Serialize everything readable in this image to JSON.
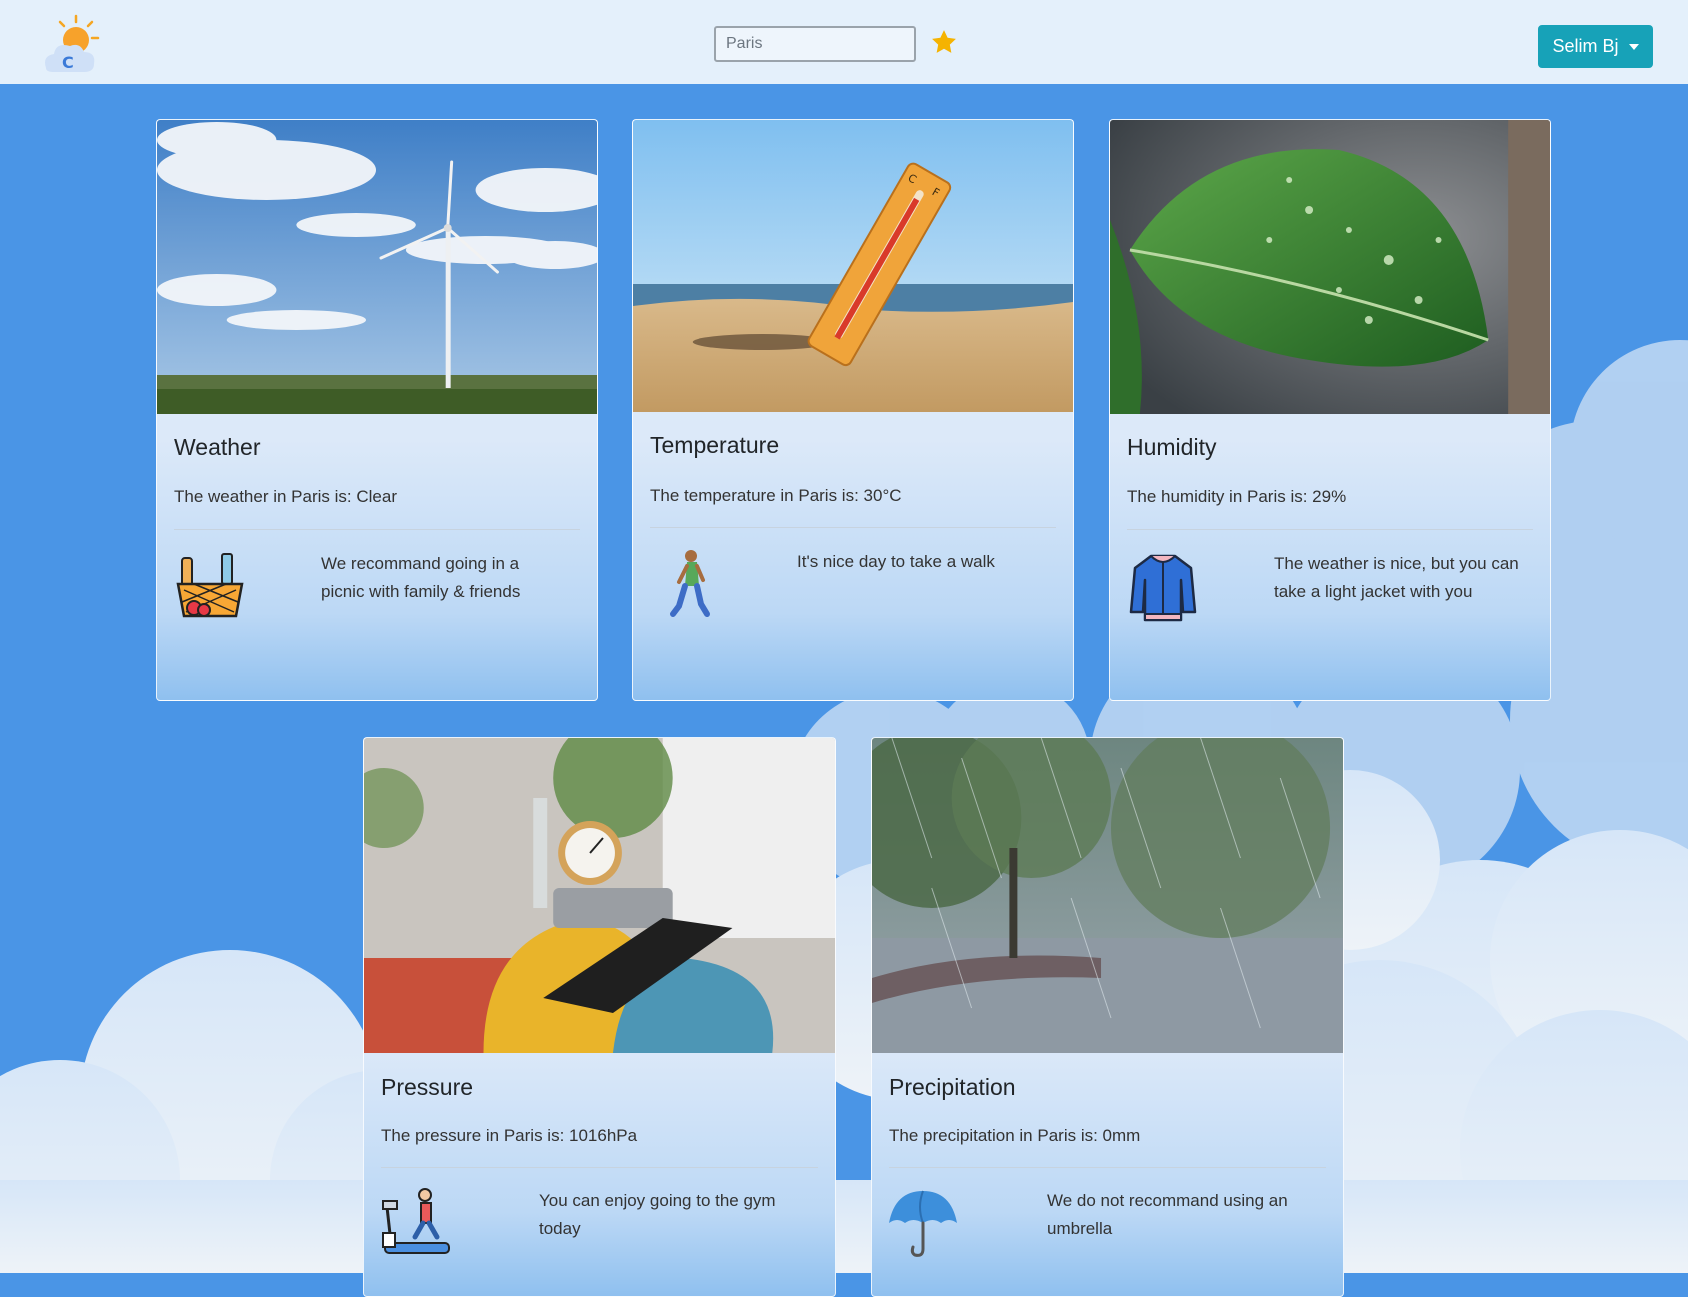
{
  "header": {
    "search": {
      "value": "",
      "placeholder": "Paris"
    },
    "user_menu": {
      "label": "Selim Bj"
    }
  },
  "cards": [
    {
      "title": "Weather",
      "value_text": "The weather in Paris is: Clear",
      "tip": "We recommand going in a picnic with family & friends",
      "image": "wind-turbine-photo",
      "icon": "picnic-basket-icon"
    },
    {
      "title": "Temperature",
      "value_text": "The temperature in Paris is: 30°C",
      "tip": "It's nice day to take a walk",
      "image": "thermometer-on-beach-photo",
      "icon": "walking-person-icon"
    },
    {
      "title": "Humidity",
      "value_text": "The humidity in Paris is: 29%",
      "tip": "The weather is nice, but you can take a light jacket with you",
      "image": "wet-leaf-photo",
      "icon": "jacket-icon"
    },
    {
      "title": "Pressure",
      "value_text": "The pressure in Paris is: 1016hPa",
      "tip": "You can enjoy going to the gym today",
      "image": "pressure-gauge-photo",
      "icon": "treadmill-icon"
    },
    {
      "title": "Precipitation",
      "value_text": "The precipitation in Paris is: 0mm",
      "tip": "We do not recommand using an umbrella",
      "image": "rainy-street-photo",
      "icon": "umbrella-icon"
    }
  ],
  "colors": {
    "accent": "#17a2b8",
    "background": "#4a95e6",
    "navbar": "#e4f0fb",
    "star": "#f5b301"
  }
}
